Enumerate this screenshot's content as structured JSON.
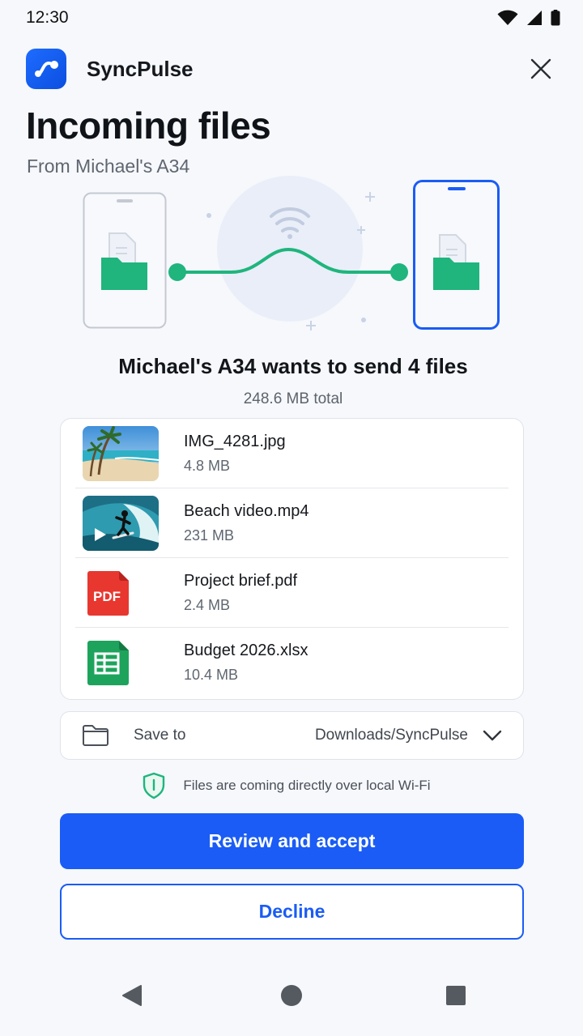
{
  "status_bar": {
    "time": "12:30",
    "icons": [
      "wifi-icon",
      "cellular-signal-icon",
      "battery-icon"
    ]
  },
  "app": {
    "name": "SyncPulse",
    "logo_icon": "syncpulse-logo-icon",
    "close_icon": "close-icon"
  },
  "page": {
    "title": "Incoming files",
    "subtitle": "From Michael's A34"
  },
  "transfer": {
    "heading": "Michael's A34 wants to send 4 files",
    "total": "248.6 MB total"
  },
  "files": [
    {
      "name": "IMG_4281.jpg",
      "size": "4.8 MB",
      "kind": "image-thumbnail"
    },
    {
      "name": "Beach video.mp4",
      "size": "231 MB",
      "kind": "video-thumbnail"
    },
    {
      "name": "Project brief.pdf",
      "size": "2.4 MB",
      "kind": "pdf-icon",
      "badge": "PDF"
    },
    {
      "name": "Budget 2026.xlsx",
      "size": "10.4 MB",
      "kind": "spreadsheet-icon"
    }
  ],
  "save_to": {
    "label": "Save to",
    "value": "Downloads/SyncPulse",
    "icon": "folder-icon"
  },
  "notice": {
    "text": "Files are coming directly over local Wi-Fi",
    "icon": "shield-icon"
  },
  "actions": {
    "accept_label": "Review and accept",
    "decline_label": "Decline"
  },
  "colors": {
    "accent": "#1a5cf5",
    "success_green": "#1fb57d",
    "background": "#f6f8fc"
  }
}
